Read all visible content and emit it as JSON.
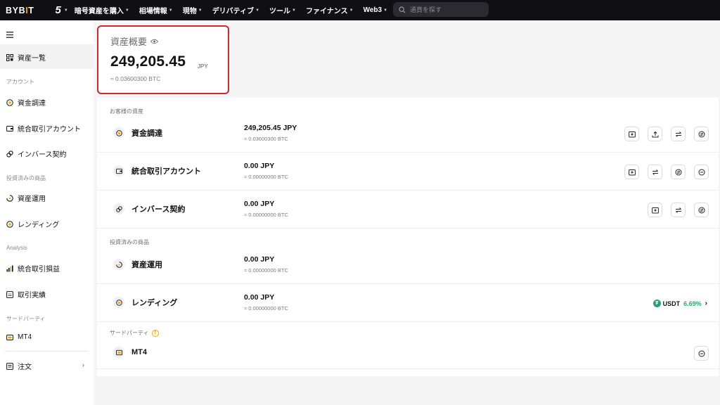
{
  "nav": {
    "logo": "BYBIT",
    "grid_label": "5",
    "items": [
      "暗号資産を購入",
      "相場情報",
      "現物",
      "デリバティブ",
      "ツール",
      "ファイナンス",
      "Web3"
    ],
    "search_placeholder": "通貨を探す"
  },
  "sidebar": {
    "active_item": "資産一覧",
    "sections": [
      "アカウント",
      "投資済みの商品",
      "Analysis",
      "サードパーティ"
    ],
    "account_items": [
      "資金調達",
      "統合取引アカウント",
      "インバース契約"
    ],
    "invested_items": [
      "資産運用",
      "レンディング"
    ],
    "analysis_items": [
      "統合取引損益",
      "取引実績"
    ],
    "third_party_items": [
      "MT4"
    ],
    "order_item": "注文"
  },
  "overview": {
    "title": "資産概要",
    "amount": "249,205.45",
    "unit": "JPY",
    "btc": "≈ 0.03600300 BTC"
  },
  "assets": {
    "section_customer": "お客様の資産",
    "section_invested": "投資済みの商品",
    "section_third": "サードパーティ",
    "rows": [
      {
        "name": "資金調達",
        "value": "249,205.45 JPY",
        "btc": "≈ 0.03600300 BTC"
      },
      {
        "name": "統合取引アカウント",
        "value": "0.00 JPY",
        "btc": "≈ 0.00000000 BTC"
      },
      {
        "name": "インバース契約",
        "value": "0.00 JPY",
        "btc": "≈ 0.00000000 BTC"
      },
      {
        "name": "資産運用",
        "value": "0.00 JPY",
        "btc": "≈ 0.00000000 BTC"
      },
      {
        "name": "レンディング",
        "value": "0.00 JPY",
        "btc": "≈ 0.00000000 BTC"
      },
      {
        "name": "MT4"
      }
    ],
    "lending_coin": "USDT",
    "lending_rate": "6.69%"
  },
  "colors": {
    "nav_bg": "#101014",
    "highlight_border": "#d6242e",
    "accent": "#f7a600",
    "positive": "#20b26c",
    "usdt": "#26a17b"
  }
}
